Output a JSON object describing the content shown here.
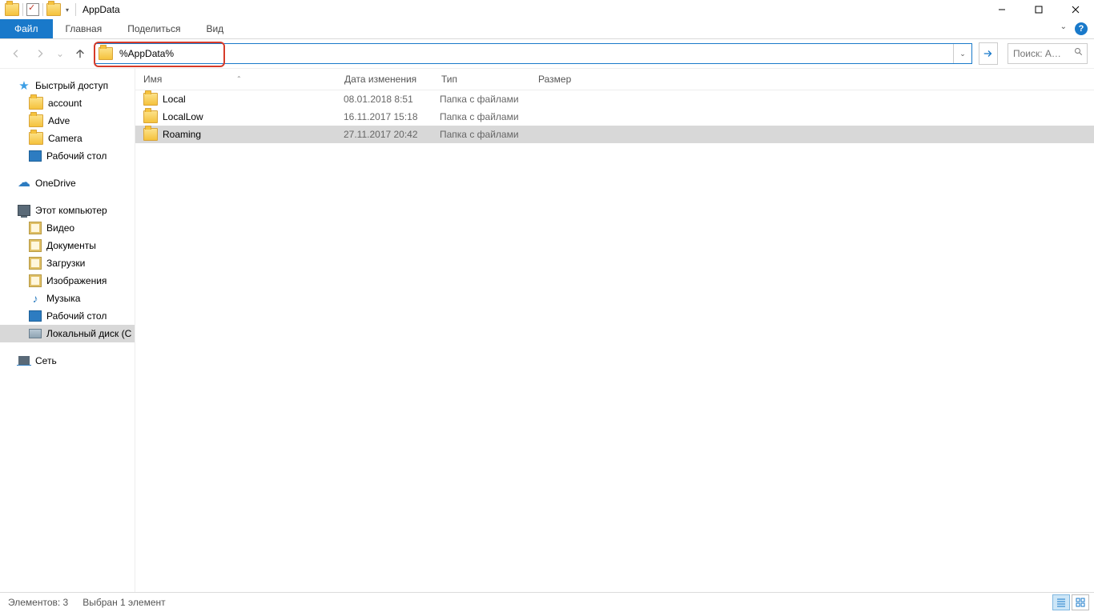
{
  "title": "AppData",
  "ribbon": {
    "file": "Файл",
    "tabs": [
      "Главная",
      "Поделиться",
      "Вид"
    ]
  },
  "address": {
    "value": "%AppData%"
  },
  "search": {
    "placeholder": "Поиск: A…"
  },
  "sidebar": {
    "quick_access": "Быстрый доступ",
    "quick_items": [
      "account",
      "Adve",
      "Camera",
      "Рабочий стол"
    ],
    "onedrive": "OneDrive",
    "this_pc": "Этот компьютер",
    "pc_items": [
      "Видео",
      "Документы",
      "Загрузки",
      "Изображения",
      "Музыка",
      "Рабочий стол",
      "Локальный диск (C"
    ],
    "network": "Сеть"
  },
  "columns": {
    "name": "Имя",
    "date": "Дата изменения",
    "type": "Тип",
    "size": "Размер"
  },
  "rows": [
    {
      "name": "Local",
      "date": "08.01.2018 8:51",
      "type": "Папка с файлами",
      "size": "",
      "selected": false
    },
    {
      "name": "LocalLow",
      "date": "16.11.2017 15:18",
      "type": "Папка с файлами",
      "size": "",
      "selected": false
    },
    {
      "name": "Roaming",
      "date": "27.11.2017 20:42",
      "type": "Папка с файлами",
      "size": "",
      "selected": true
    }
  ],
  "status": {
    "count": "Элементов: 3",
    "selection": "Выбран 1 элемент"
  }
}
